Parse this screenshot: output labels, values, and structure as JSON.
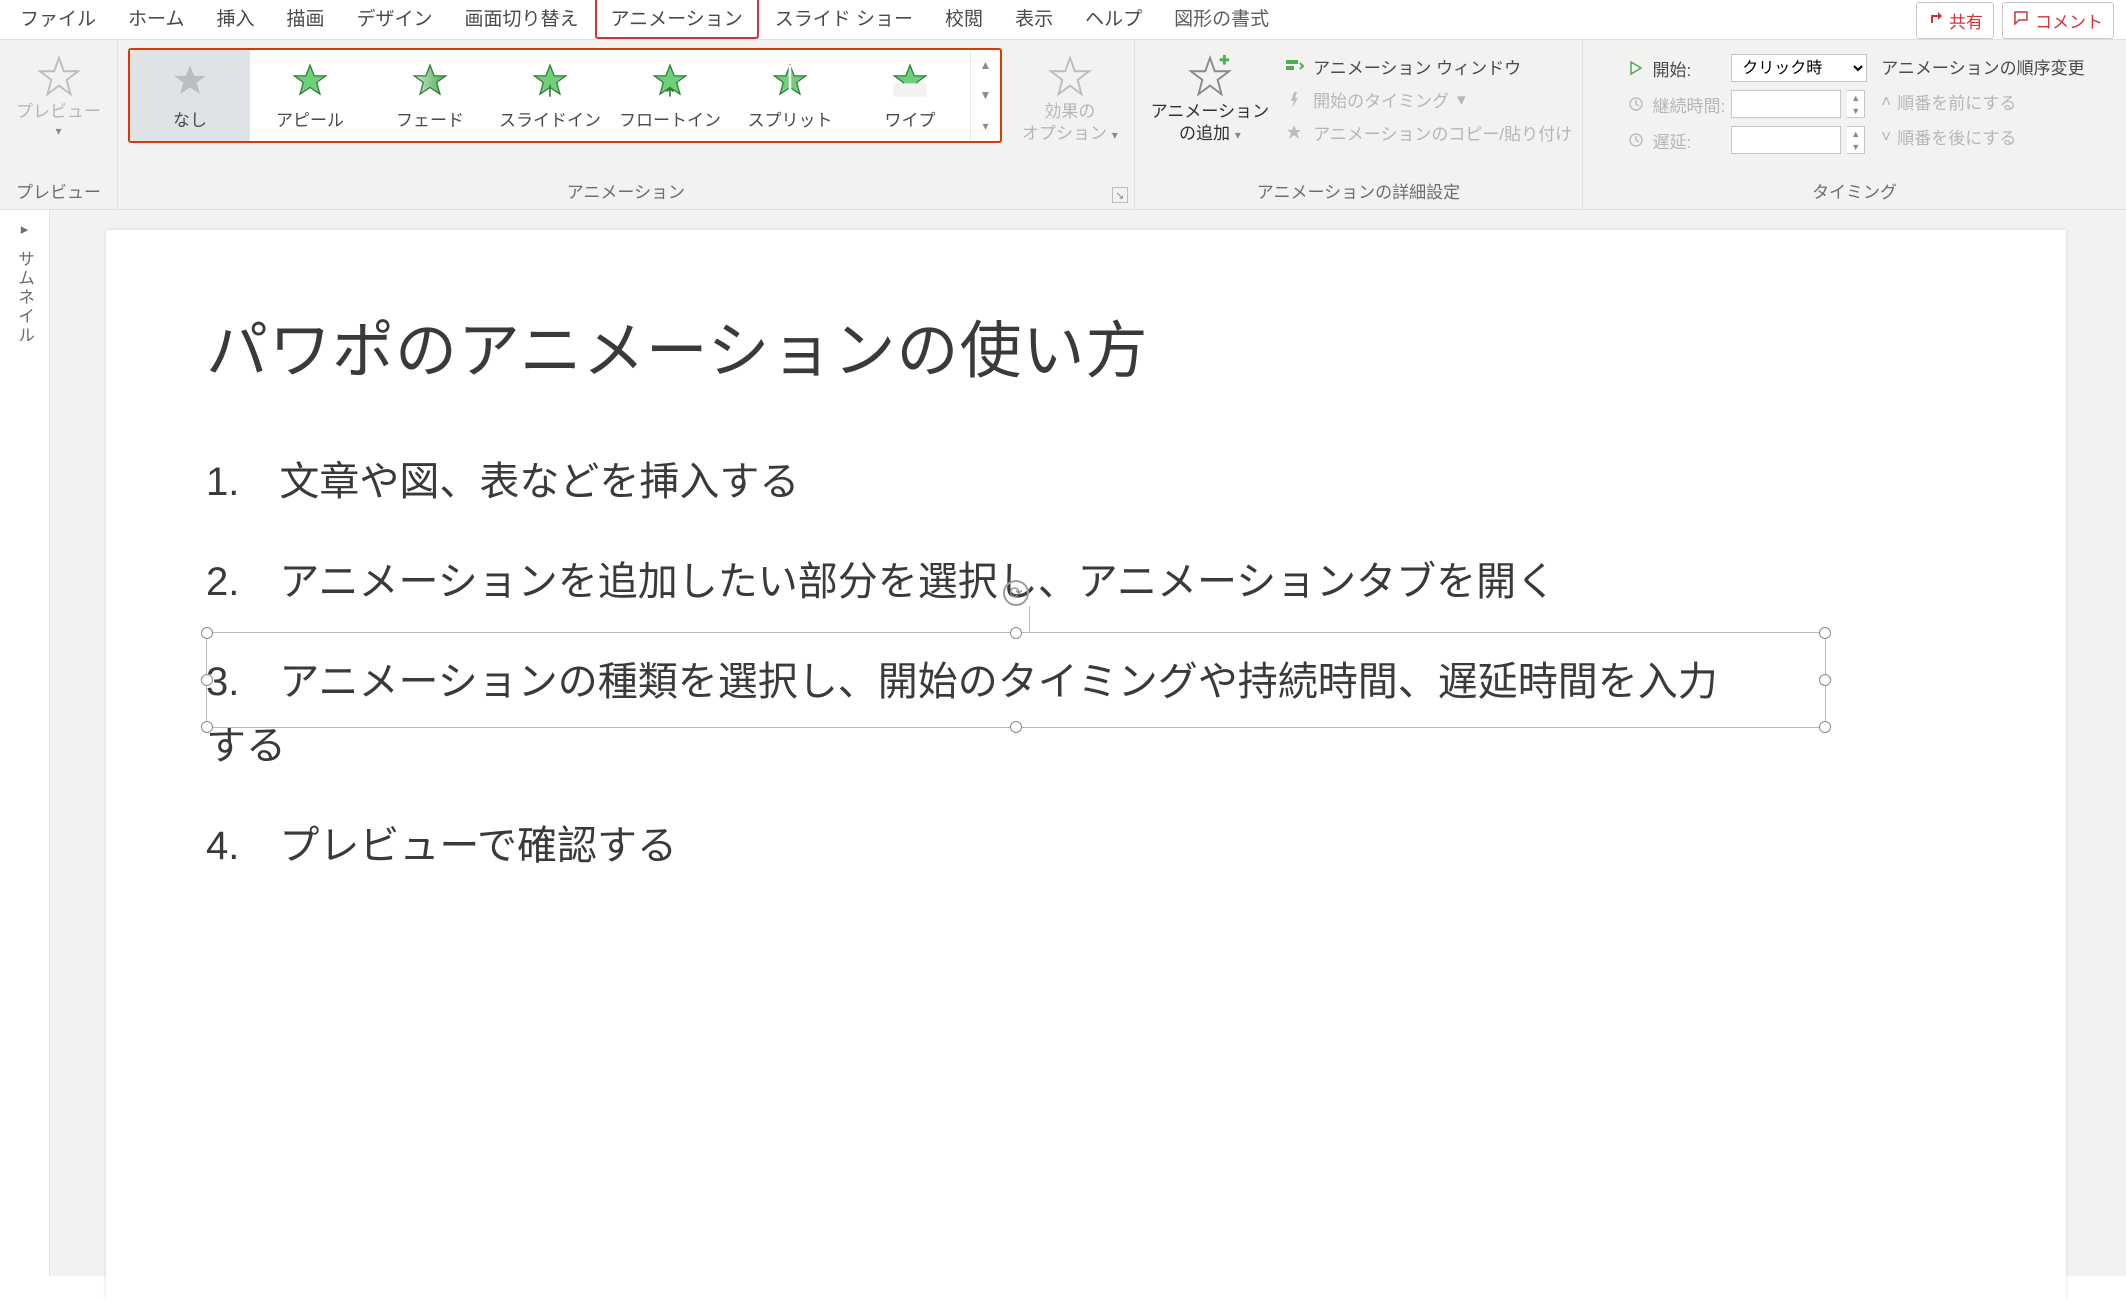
{
  "tabs": {
    "file": "ファイル",
    "home": "ホーム",
    "insert": "挿入",
    "draw": "描画",
    "design": "デザイン",
    "transition": "画面切り替え",
    "animation": "アニメーション",
    "slideshow": "スライド ショー",
    "review": "校閲",
    "view": "表示",
    "help": "ヘルプ",
    "shape_format": "図形の書式"
  },
  "commands": {
    "share": "共有",
    "comment": "コメント"
  },
  "ribbon": {
    "preview_group": "プレビュー",
    "preview_btn": "プレビュー",
    "animation_group": "アニメーション",
    "gallery": {
      "none": "なし",
      "appear": "アピール",
      "fade": "フェード",
      "slidein": "スライドイン",
      "floatin": "フロートイン",
      "split": "スプリット",
      "wipe": "ワイプ"
    },
    "effect_options_l1": "効果の",
    "effect_options_l2": "オプション",
    "add_animation_l1": "アニメーション",
    "add_animation_l2": "の追加",
    "advanced_group": "アニメーションの詳細設定",
    "anim_pane": "アニメーション ウィンドウ",
    "trigger": "開始のタイミング",
    "anim_painter": "アニメーションのコピー/貼り付け",
    "timing_group": "タイミング",
    "start_label": "開始:",
    "start_value": "クリック時",
    "duration_label": "継続時間:",
    "delay_label": "遅延:",
    "order_title": "アニメーションの順序変更",
    "order_earlier": "順番を前にする",
    "order_later": "順番を後にする"
  },
  "thumbnail_label": "サムネイル",
  "slide": {
    "title": "パワポのアニメーションの使い方",
    "items": [
      "1.　文章や図、表などを挿入する",
      "2.　アニメーションを追加したい部分を選択し、アニメーションタブを開く",
      "3.　アニメーションの種類を選択し、開始のタイミングや持続時間、遅延時間を入力する",
      "4.　プレビューで確認する"
    ]
  }
}
